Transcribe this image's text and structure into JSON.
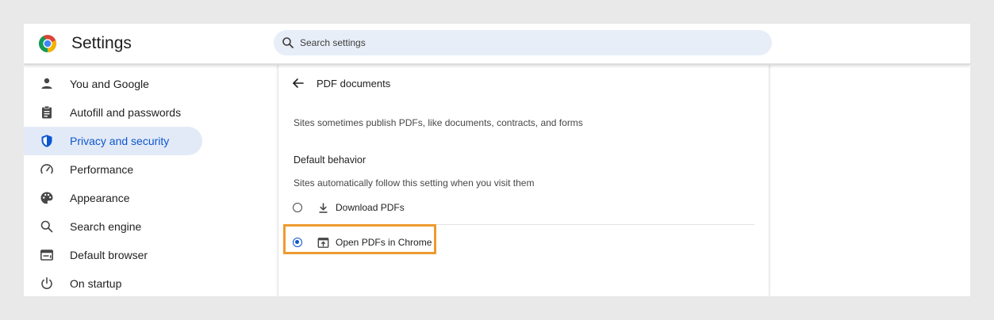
{
  "app": {
    "title": "Settings"
  },
  "search": {
    "placeholder": "Search settings"
  },
  "sidebar": {
    "items": [
      {
        "label": "You and Google",
        "icon": "person-icon",
        "active": false
      },
      {
        "label": "Autofill and passwords",
        "icon": "clipboard-icon",
        "active": false
      },
      {
        "label": "Privacy and security",
        "icon": "shield-icon",
        "active": true
      },
      {
        "label": "Performance",
        "icon": "speedometer-icon",
        "active": false
      },
      {
        "label": "Appearance",
        "icon": "palette-icon",
        "active": false
      },
      {
        "label": "Search engine",
        "icon": "search-icon",
        "active": false
      },
      {
        "label": "Default browser",
        "icon": "browser-window-icon",
        "active": false
      },
      {
        "label": "On startup",
        "icon": "power-icon",
        "active": false
      }
    ]
  },
  "main": {
    "title": "PDF documents",
    "description": "Sites sometimes publish PDFs, like documents, contracts, and forms",
    "section_title": "Default behavior",
    "section_description": "Sites automatically follow this setting when you visit them",
    "options": [
      {
        "label": "Download PDFs",
        "icon": "download-icon",
        "selected": false
      },
      {
        "label": "Open PDFs in Chrome",
        "icon": "open-in-browser-icon",
        "selected": true
      }
    ]
  },
  "colors": {
    "accent": "#0b57d0",
    "active_bg": "#e3eaf7",
    "search_bg": "#e8eef8",
    "highlight": "#ee9a2f",
    "page_bg": "#e9e9e9"
  }
}
